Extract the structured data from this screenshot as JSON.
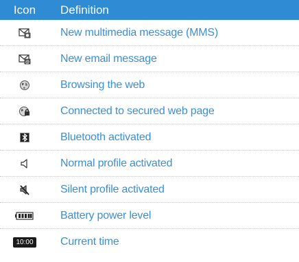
{
  "header": {
    "icon_col": "Icon",
    "definition_col": "Definition"
  },
  "rows": [
    {
      "icon": "mms-envelope-icon",
      "definition": "New multimedia message (MMS)"
    },
    {
      "icon": "email-envelope-icon",
      "definition": "New email message"
    },
    {
      "icon": "globe-icon",
      "definition": "Browsing the web"
    },
    {
      "icon": "secure-globe-icon",
      "definition": "Connected to secured web page"
    },
    {
      "icon": "bluetooth-icon",
      "definition": "Bluetooth activated"
    },
    {
      "icon": "speaker-icon",
      "definition": "Normal profile activated"
    },
    {
      "icon": "speaker-muted-icon",
      "definition": "Silent profile activated"
    },
    {
      "icon": "battery-icon",
      "definition": "Battery power level"
    },
    {
      "icon": "clock-badge-icon",
      "definition": "Current time",
      "badge_text": "10:00"
    }
  ],
  "colors": {
    "header_bg": "#2f8cd4",
    "link_text": "#3a8fd6"
  }
}
